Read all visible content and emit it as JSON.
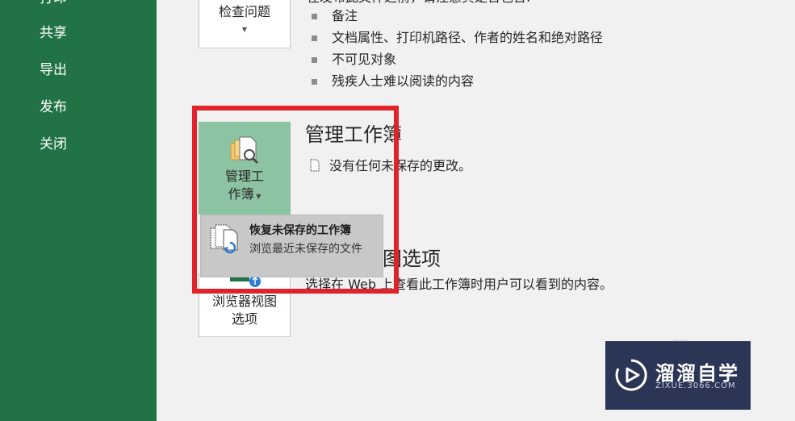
{
  "nav": {
    "items": [
      {
        "label": "打印"
      },
      {
        "label": "共享"
      },
      {
        "label": "导出"
      },
      {
        "label": "发布"
      },
      {
        "label": "关闭"
      }
    ]
  },
  "inspect": {
    "button_label": "检查问题",
    "intro_text": "在发布此文件之前，请注意其是否包含:",
    "bullets": [
      "备注",
      "文档属性、打印机路径、作者的姓名和绝对路径",
      "不可见对象",
      "残疾人士难以阅读的内容"
    ]
  },
  "manage": {
    "button_label_line1": "管理工",
    "button_label_line2": "作簿",
    "title": "管理工作簿",
    "status": "没有任何未保存的更改。"
  },
  "dropdown": {
    "title": "恢复未保存的工作簿",
    "description": "浏览最近未保存的文件"
  },
  "browser_view": {
    "button_label_line1": "浏览器视图",
    "button_label_line2": "选项",
    "title": "浏览器视图选项",
    "description": "选择在 Web 上查看此工作簿时用户可以看到的内容。"
  },
  "watermark": {
    "title": "溜溜自学",
    "subtitle": "ZIXUE.3066.COM"
  },
  "colors": {
    "nav_green": "#217346",
    "selected_tile": "#8cc3a2",
    "highlight_red": "#e0222a",
    "watermark_bg": "#2b3556"
  }
}
